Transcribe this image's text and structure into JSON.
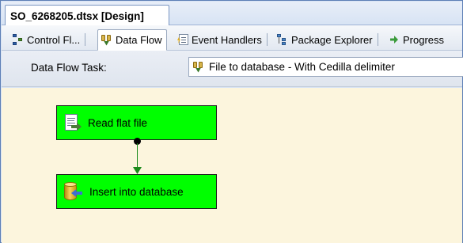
{
  "document": {
    "tab_title": "SO_6268205.dtsx [Design]"
  },
  "designer_tabs": [
    {
      "label": "Control Fl...",
      "icon": "control-flow-icon",
      "active": false
    },
    {
      "label": "Data Flow",
      "icon": "data-flow-icon",
      "active": true
    },
    {
      "label": "Event Handlers",
      "icon": "event-handlers-icon",
      "active": false
    },
    {
      "label": "Package Explorer",
      "icon": "package-explorer-icon",
      "active": false
    },
    {
      "label": "Progress",
      "icon": "progress-icon",
      "active": false
    }
  ],
  "task_bar": {
    "label": "Data Flow Task:",
    "selected_task": "File to database - With Cedilla delimiter",
    "icon": "data-flow-task-icon"
  },
  "canvas": {
    "background": "#fcf5dd",
    "components": [
      {
        "label": "Read flat file",
        "icon": "flat-file-source-icon",
        "color": "#00ff00"
      },
      {
        "label": "Insert into database",
        "icon": "ole-db-destination-icon",
        "color": "#00ff00"
      }
    ],
    "path_color": "#1a8a1a"
  }
}
